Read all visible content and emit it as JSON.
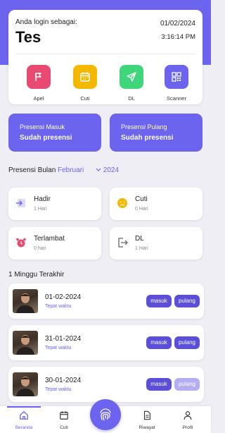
{
  "colors": {
    "primary": "#6c63ef",
    "pill": "#5b4fd9",
    "pill_faded": "#b3adf2",
    "background": "#eeeef4"
  },
  "header": {
    "login_label": "Anda login sebagai:",
    "user_name": "Tes",
    "date": "01/02/2024",
    "time": "3:16:14 PM"
  },
  "actions": [
    {
      "label": "Apel",
      "icon": "flag-icon",
      "color": "#e84a72"
    },
    {
      "label": "Cuti",
      "icon": "calendar-icon",
      "color": "#f5b800"
    },
    {
      "label": "DL",
      "icon": "send-icon",
      "color": "#3fd67b"
    },
    {
      "label": "Scanner",
      "icon": "qr-code-icon",
      "color": "#6c63ef"
    }
  ],
  "presensi": {
    "masuk": {
      "title": "Presensi Masuk",
      "status": "Sudah presensi"
    },
    "pulang": {
      "title": "Presensi Pulang",
      "status": "Sudah presensi"
    }
  },
  "month_selector": {
    "label": "Presensi Bulan",
    "month": "Februari",
    "year": "2024"
  },
  "stats": [
    {
      "name": "Hadir",
      "value": "1 Hari",
      "icon": "login-arrow-icon"
    },
    {
      "name": "Cuti",
      "value": "0 Hari",
      "icon": "sad-face-icon"
    },
    {
      "name": "Terlambat",
      "value": "0 hari",
      "icon": "alarm-clock-icon"
    },
    {
      "name": "DL",
      "value": "1 Hari",
      "icon": "logout-arrow-icon"
    }
  ],
  "week": {
    "title": "1 Minggu Terakhir",
    "items": [
      {
        "date": "01-02-2024",
        "status": "Tepat waktu",
        "masuk": "masuk",
        "pulang": "pulang",
        "pulang_done": true
      },
      {
        "date": "31-01-2024",
        "status": "Tepat waktu",
        "masuk": "masuk",
        "pulang": "pulang",
        "pulang_done": true
      },
      {
        "date": "30-01-2024",
        "status": "Tepat waktu",
        "masuk": "masuk",
        "pulang": "pulang",
        "pulang_done": false
      }
    ]
  },
  "nav": [
    {
      "label": "Beranda",
      "icon": "home-icon",
      "active": true
    },
    {
      "label": "Cuti",
      "icon": "calendar-icon",
      "active": false
    },
    {
      "label": "Riwayat",
      "icon": "document-icon",
      "active": false
    },
    {
      "label": "Profil",
      "icon": "user-icon",
      "active": false
    }
  ],
  "center_button": {
    "icon": "fingerprint-icon"
  }
}
